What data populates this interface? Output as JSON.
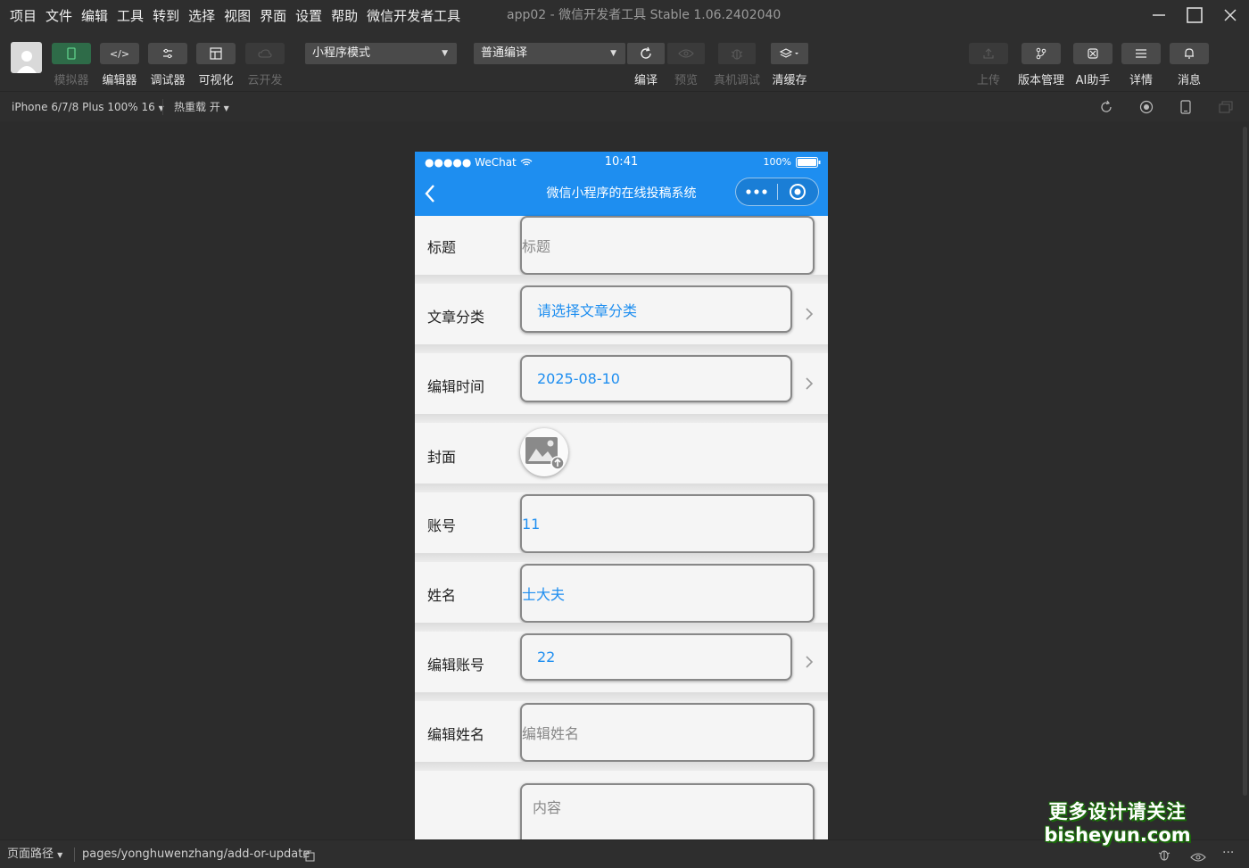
{
  "menu": [
    "项目",
    "文件",
    "编辑",
    "工具",
    "转到",
    "选择",
    "视图",
    "界面",
    "设置",
    "帮助",
    "微信开发者工具"
  ],
  "window_title": "app02 - 微信开发者工具 Stable 1.06.2402040",
  "toolbar": {
    "left_buttons": [
      {
        "label": "模拟器",
        "icon": "phone-icon",
        "state": "active"
      },
      {
        "label": "编辑器",
        "icon": "code-icon",
        "state": "normal"
      },
      {
        "label": "调试器",
        "icon": "debug-sliders-icon",
        "state": "normal"
      },
      {
        "label": "可视化",
        "icon": "layout-icon",
        "state": "normal"
      },
      {
        "label": "云开发",
        "icon": "cloud-icon",
        "state": "disabled"
      }
    ],
    "mode_select": "小程序模式",
    "compile_select": "普通编译",
    "actions": [
      {
        "label": "编译",
        "icon": "refresh-icon",
        "state": "normal"
      },
      {
        "label": "预览",
        "icon": "eye-icon",
        "state": "disabled"
      },
      {
        "label": "真机调试",
        "icon": "bug-icon",
        "state": "disabled"
      },
      {
        "label": "清缓存",
        "icon": "layers-icon",
        "state": "normal"
      }
    ],
    "right_buttons": [
      {
        "label": "上传",
        "icon": "upload-icon",
        "state": "disabled"
      },
      {
        "label": "版本管理",
        "icon": "branch-icon",
        "state": "normal"
      },
      {
        "label": "AI助手",
        "icon": "ai-icon",
        "state": "normal"
      },
      {
        "label": "详情",
        "icon": "menu-lines-icon",
        "state": "normal"
      },
      {
        "label": "消息",
        "icon": "bell-icon",
        "state": "normal"
      }
    ]
  },
  "devbar": {
    "device": "iPhone 6/7/8 Plus 100% 16",
    "hot_reload": "热重载 开"
  },
  "phone": {
    "status": {
      "signal": "●●●●● WeChat",
      "time": "10:41",
      "battery": "100%"
    },
    "nav_title": "微信小程序的在线投稿系统",
    "fields": [
      {
        "label": "标题",
        "placeholder": "标题",
        "value": ""
      },
      {
        "label": "文章分类",
        "placeholder": "",
        "value": "请选择文章分类"
      },
      {
        "label": "编辑时间",
        "placeholder": "",
        "value": "2025-08-10"
      },
      {
        "label": "封面"
      },
      {
        "label": "账号",
        "placeholder": "",
        "value": "11"
      },
      {
        "label": "姓名",
        "placeholder": "",
        "value": "士大夫"
      },
      {
        "label": "编辑账号",
        "placeholder": "",
        "value": "22"
      },
      {
        "label": "编辑姓名",
        "placeholder": "编辑姓名",
        "value": ""
      },
      {
        "label": "",
        "placeholder": "内容",
        "value": ""
      }
    ]
  },
  "bottombar": {
    "path_label": "页面路径",
    "path": "pages/yonghuwenzhang/add-or-update"
  },
  "watermark": {
    "line1": "更多设计请关注",
    "line2": "bisheyun.com"
  },
  "colors": {
    "accent": "#1e8ef0",
    "active_green": "#2e6b48",
    "chrome": "#2e2e2e"
  }
}
